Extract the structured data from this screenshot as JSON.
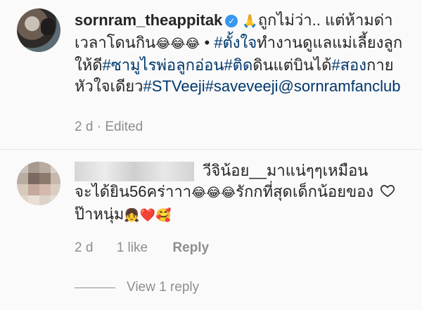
{
  "post": {
    "username": "sornram_theappitak",
    "caption_parts": [
      {
        "type": "emoji",
        "value": "🙏"
      },
      {
        "type": "text",
        "value": "ถูกไม่ว่า.. แต่ห้ามด่าเวลาโดนกิน"
      },
      {
        "type": "emoji",
        "value": "😂😂😂"
      },
      {
        "type": "text",
        "value": " • "
      },
      {
        "type": "tag",
        "value": "#ตั้งใจ"
      },
      {
        "type": "text",
        "value": "ทำงานดูแลแม่เลี้ยงลูกให้ดี"
      },
      {
        "type": "tag",
        "value": "#ซามูไรพ่อลูกอ่อน#ติด"
      },
      {
        "type": "text",
        "value": "ดินแต่บินได้"
      },
      {
        "type": "tag",
        "value": "#สอง"
      },
      {
        "type": "text",
        "value": "กายหัวใจเดียว"
      },
      {
        "type": "tag",
        "value": "#STVeeji#saveveeji@sornramfanclub"
      }
    ],
    "time": "2 d",
    "separator": "·",
    "edited": "Edited"
  },
  "comment": {
    "text_1": "วีจิน้อย__มาแน่ๆๆเหมือนจะได้ยิน56คร่าาา",
    "emoji_1": "😂😂😂",
    "text_2": "รักกที่สุดเด็กน้อยของป๊าหนุ่ม",
    "emoji_2": "👧❤️🥰",
    "time": "2 d",
    "likes": "1 like",
    "reply": "Reply",
    "view_replies": "View 1 reply"
  }
}
